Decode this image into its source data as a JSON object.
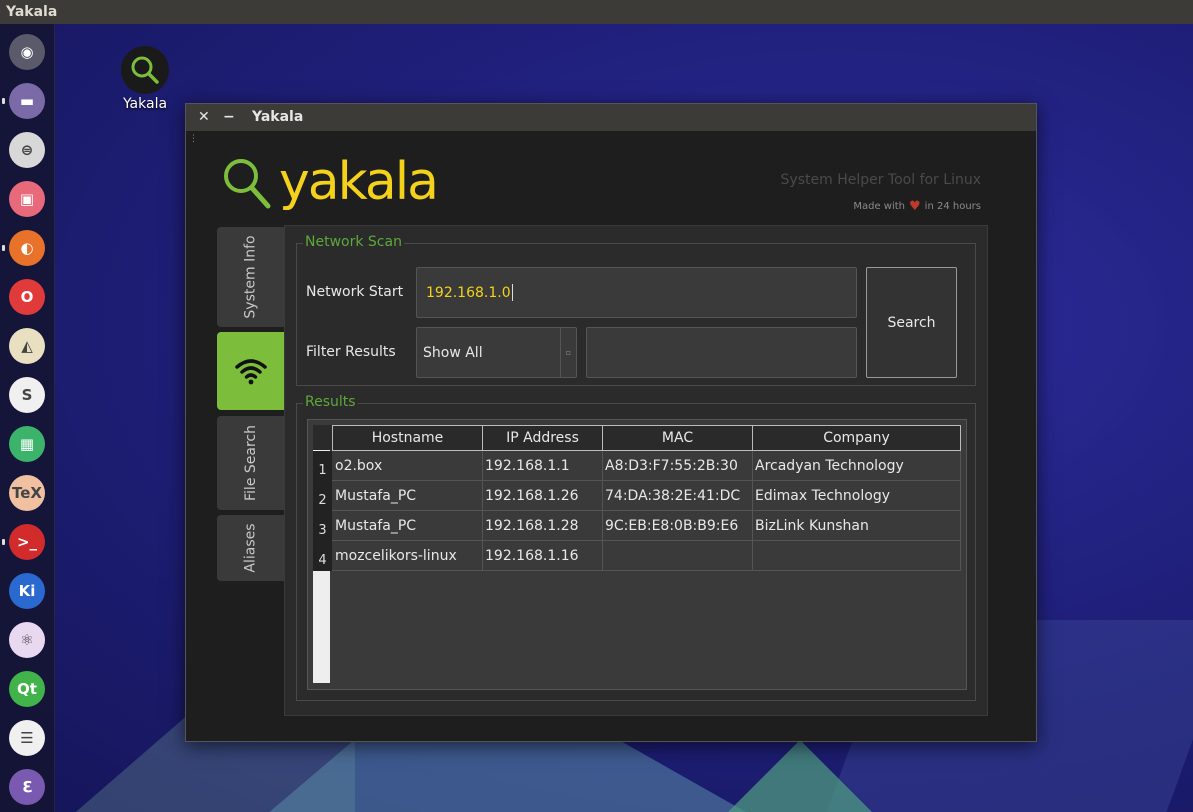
{
  "topbar": {
    "app_name": "Yakala"
  },
  "desktop_icon": {
    "label": "Yakala"
  },
  "launcher": {
    "items": [
      {
        "name": "ubuntu-dash-icon",
        "glyph": "◉",
        "color": "#5a5a6a",
        "pip": false
      },
      {
        "name": "files-icon",
        "glyph": "▬",
        "color": "#7a6aa8",
        "pip": true
      },
      {
        "name": "settings-toggle-icon",
        "glyph": "⊜",
        "color": "#d8d8d8",
        "pip": false
      },
      {
        "name": "slides-icon",
        "glyph": "▣",
        "color": "#e86a7a",
        "pip": false
      },
      {
        "name": "firefox-icon",
        "glyph": "◐",
        "color": "#e8722a",
        "pip": true
      },
      {
        "name": "opera-icon",
        "glyph": "O",
        "color": "#e03a3a",
        "pip": false
      },
      {
        "name": "inkscape-icon",
        "glyph": "◭",
        "color": "#e8e0c0",
        "pip": false
      },
      {
        "name": "slack-icon",
        "glyph": "S",
        "color": "#f0f0f0",
        "pip": false
      },
      {
        "name": "spreadsheet-icon",
        "glyph": "▦",
        "color": "#3bb36b",
        "pip": false
      },
      {
        "name": "texstudio-icon",
        "glyph": "TeX",
        "color": "#f0c0a0",
        "pip": false
      },
      {
        "name": "terminal-icon",
        "glyph": ">_",
        "color": "#d12b2b",
        "pip": true
      },
      {
        "name": "kile-icon",
        "glyph": "Ki",
        "color": "#2a6ad0",
        "pip": false
      },
      {
        "name": "atom-icon",
        "glyph": "⚛",
        "color": "#e8d8f0",
        "pip": false
      },
      {
        "name": "qt-creator-icon",
        "glyph": "Qt",
        "color": "#41b34a",
        "pip": false
      },
      {
        "name": "eclipse-icon",
        "glyph": "☰",
        "color": "#f0f0f0",
        "pip": false
      },
      {
        "name": "emacs-icon",
        "glyph": "ℇ",
        "color": "#7a5ab0",
        "pip": false
      }
    ]
  },
  "window": {
    "title": "Yakala",
    "close_glyph": "✕",
    "min_glyph": "−",
    "logo_text": "yakala",
    "tagline": "System Helper Tool for Linux",
    "made_with_prefix": "Made with",
    "made_with_suffix": "in 24 hours",
    "accent_color": "#7cbd3c",
    "logo_color": "#f4d21b"
  },
  "tabs": [
    {
      "label": "System Info",
      "active": false
    },
    {
      "label": "",
      "icon": "wifi-icon",
      "active": true
    },
    {
      "label": "File Search",
      "active": false
    },
    {
      "label": "Aliases",
      "active": false
    }
  ],
  "network_scan": {
    "group_title": "Network Scan",
    "network_start_label": "Network Start",
    "network_start_value": "192.168.1.0",
    "filter_label": "Filter Results",
    "filter_selected": "Show All",
    "filter_text_value": "",
    "search_button": "Search"
  },
  "results": {
    "group_title": "Results",
    "columns": [
      "Hostname",
      "IP Address",
      "MAC",
      "Company"
    ],
    "rows": [
      {
        "num": "1",
        "hostname": "o2.box",
        "ip": "192.168.1.1",
        "mac": "A8:D3:F7:55:2B:30",
        "company": "Arcadyan Technology"
      },
      {
        "num": "2",
        "hostname": "Mustafa_PC",
        "ip": "192.168.1.26",
        "mac": "74:DA:38:2E:41:DC",
        "company": "Edimax Technology"
      },
      {
        "num": "3",
        "hostname": "Mustafa_PC",
        "ip": "192.168.1.28",
        "mac": "9C:EB:E8:0B:B9:E6",
        "company": "BizLink Kunshan"
      },
      {
        "num": "4",
        "hostname": "mozcelikors-linux",
        "ip": "192.168.1.16",
        "mac": "",
        "company": ""
      }
    ]
  }
}
